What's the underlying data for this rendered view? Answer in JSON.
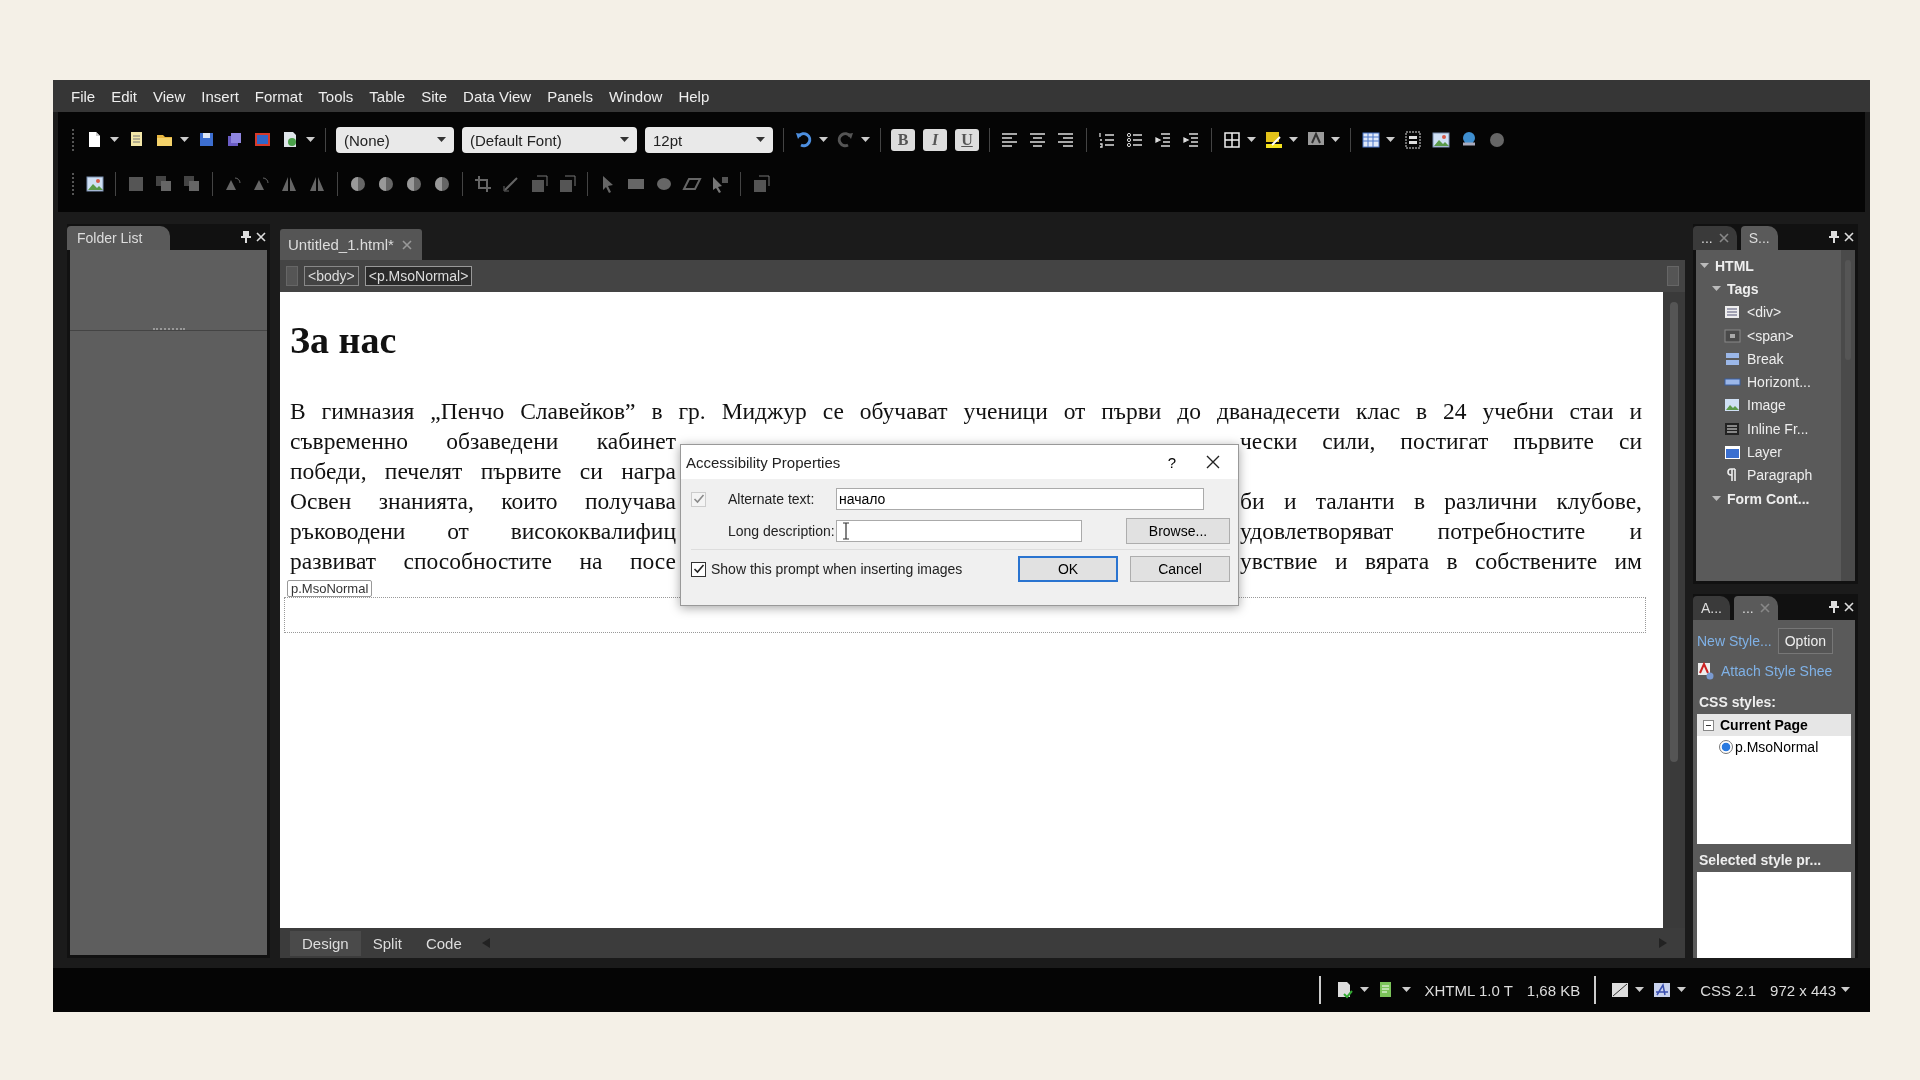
{
  "menu": [
    "File",
    "Edit",
    "View",
    "Insert",
    "Format",
    "Tools",
    "Table",
    "Site",
    "Data View",
    "Panels",
    "Window",
    "Help"
  ],
  "toolbar": {
    "dropdowns": [
      {
        "value": "(None)"
      },
      {
        "value": "(Default Font)"
      },
      {
        "value": "12pt"
      }
    ],
    "format_buttons": [
      "B",
      "I",
      "U"
    ]
  },
  "folder_panel": {
    "title": "Folder List"
  },
  "editor": {
    "tabs": [
      {
        "label": "Untitled_1.html*"
      }
    ],
    "breadcrumb": [
      {
        "label": "<body>",
        "selected": false
      },
      {
        "label": "<p.MsoNormal>",
        "selected": true
      }
    ],
    "heading": "За нас",
    "lines": [
      {
        "kind": "whole",
        "left": "В гимназия „Пенчо Славейков” в гр. Миджур се обучават ученици от първи до дванадесети клас в 24 учебни стаи и"
      },
      {
        "kind": "split",
        "left": "съвременно обзаведени кабинет",
        "right": "чески сили, постигат първите си"
      },
      {
        "kind": "split",
        "left": "победи, печелят първите си награ"
      },
      {
        "kind": "split",
        "left": "Освен знанията, които получава",
        "right": "би и таланти в различни клубове,"
      },
      {
        "kind": "split",
        "left": "ръководени от висококвалифиц",
        "right": "удовлетворяват потребностите и"
      },
      {
        "kind": "split",
        "left": "развиват способностите на посе",
        "right": "увствие и вярата в собствените им"
      }
    ],
    "tag_label": "p.MsoNormal",
    "view_tabs": [
      {
        "label": "Design",
        "selected": true
      },
      {
        "label": "Split",
        "selected": false
      },
      {
        "label": "Code",
        "selected": false
      }
    ]
  },
  "dialog": {
    "title": "Accessibility Properties",
    "help": "?",
    "fields": [
      {
        "label": "Alternate text:",
        "value": "начало",
        "checked": true,
        "disabled": true
      },
      {
        "label": "Long description:",
        "button": "Browse..."
      }
    ],
    "prompt_checkbox": {
      "label": "Show this prompt when inserting images",
      "checked": true
    },
    "buttons": [
      {
        "label": "OK",
        "default": true
      },
      {
        "label": "Cancel",
        "default": false
      }
    ]
  },
  "tag_panel": {
    "tabs": [
      {
        "label": "...",
        "selected": false
      },
      {
        "label": "S...",
        "selected": true
      }
    ],
    "tree": [
      {
        "label": "HTML",
        "expanded": true,
        "children": [
          {
            "label": "Tags",
            "expanded": true,
            "children": [
              {
                "label": "<div>"
              },
              {
                "label": "<span>"
              },
              {
                "label": "Break"
              },
              {
                "label": "Horizont..."
              },
              {
                "label": "Image"
              },
              {
                "label": "Inline Fr..."
              },
              {
                "label": "Layer"
              },
              {
                "label": "Paragraph"
              }
            ]
          },
          {
            "label": "Form Cont...",
            "expanded": true
          }
        ]
      }
    ]
  },
  "style_panel": {
    "tabs": [
      {
        "label": "A...",
        "selected": false
      },
      {
        "label": "...",
        "selected": true
      }
    ],
    "new_style": "New Style...",
    "options_button": "Option",
    "attach_link": "Attach Style Shee",
    "heading": "CSS styles:",
    "groups": [
      {
        "label": "Current Page",
        "expanded": true,
        "items": [
          {
            "label": "p.MsoNormal",
            "selected": true
          }
        ]
      }
    ],
    "footer": "Selected style pr..."
  },
  "status_bar": {
    "doctype": "XHTML 1.0 T",
    "size": "1,68 KB",
    "css": "CSS 2.1",
    "dimensions": "972 x 443"
  }
}
